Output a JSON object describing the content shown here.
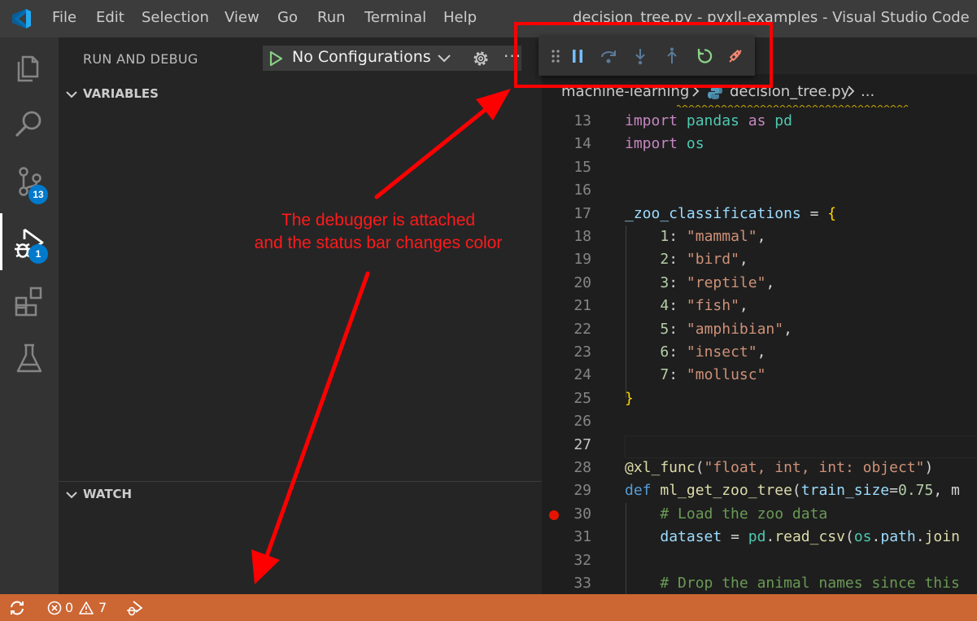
{
  "menu": [
    "File",
    "Edit",
    "Selection",
    "View",
    "Go",
    "Run",
    "Terminal",
    "Help"
  ],
  "window_title": "decision_tree.py - pyxll-examples - Visual Studio Code",
  "activity_bar": {
    "items": [
      "files-icon",
      "search-icon",
      "source-control-icon",
      "run-debug-icon",
      "extensions-icon",
      "testing-icon"
    ],
    "source_control_badge": "13",
    "debug_badge": "1"
  },
  "sidebar": {
    "title": "RUN AND DEBUG",
    "config_label": "No Configurations",
    "more": "···",
    "variables_label": "VARIABLES",
    "watch_label": "WATCH"
  },
  "breadcrumb": {
    "folder": "machine-learning",
    "file": "decision_tree.py",
    "more": "..."
  },
  "editor": {
    "lines": [
      {
        "n": "13",
        "html": "<span class='kw'>import</span> <span class='mod'>pandas</span> <span class='kw'>as</span> <span class='mod'>pd</span>"
      },
      {
        "n": "14",
        "html": "<span class='kw'>import</span> <span class='mod'>os</span>"
      },
      {
        "n": "15",
        "html": ""
      },
      {
        "n": "16",
        "html": ""
      },
      {
        "n": "17",
        "html": "<span class='var'>_zoo_classifications</span> <span class='plain'>=</span> <span class='brace'>{</span>"
      },
      {
        "n": "18",
        "html": "    <span class='num'>1</span><span class='plain'>:</span> <span class='str'>\"mammal\"</span><span class='plain'>,</span>"
      },
      {
        "n": "19",
        "html": "    <span class='num'>2</span><span class='plain'>:</span> <span class='str'>\"bird\"</span><span class='plain'>,</span>"
      },
      {
        "n": "20",
        "html": "    <span class='num'>3</span><span class='plain'>:</span> <span class='str'>\"reptile\"</span><span class='plain'>,</span>"
      },
      {
        "n": "21",
        "html": "    <span class='num'>4</span><span class='plain'>:</span> <span class='str'>\"fish\"</span><span class='plain'>,</span>"
      },
      {
        "n": "22",
        "html": "    <span class='num'>5</span><span class='plain'>:</span> <span class='str'>\"amphibian\"</span><span class='plain'>,</span>"
      },
      {
        "n": "23",
        "html": "    <span class='num'>6</span><span class='plain'>:</span> <span class='str'>\"insect\"</span><span class='plain'>,</span>"
      },
      {
        "n": "24",
        "html": "    <span class='num'>7</span><span class='plain'>:</span> <span class='str'>\"mollusc\"</span>"
      },
      {
        "n": "25",
        "html": "<span class='brace'>}</span>"
      },
      {
        "n": "26",
        "html": ""
      },
      {
        "n": "27",
        "html": ""
      },
      {
        "n": "28",
        "html": "<span class='fn'>@xl_func</span><span class='plain'>(</span><span class='str'>\"float, int, int: object\"</span><span class='plain'>)</span>"
      },
      {
        "n": "29",
        "html": "<span class='kwb'>def</span> <span class='fn'>ml_get_zoo_tree</span><span class='plain'>(</span><span class='var'>train_size</span><span class='plain'>=</span><span class='num'>0.75</span><span class='plain'>, m</span>"
      },
      {
        "n": "30",
        "html": "    <span class='cm'># Load the zoo data</span>"
      },
      {
        "n": "31",
        "html": "    <span class='var'>dataset</span> <span class='plain'>=</span> <span class='mod'>pd</span><span class='plain'>.</span><span class='fn'>read_csv</span><span class='plain'>(</span><span class='mod'>os</span><span class='plain'>.</span><span class='var'>path</span><span class='plain'>.</span><span class='fn'>join</span>"
      },
      {
        "n": "32",
        "html": ""
      },
      {
        "n": "33",
        "html": "    <span class='cm'># Drop the animal names since this</span>"
      }
    ]
  },
  "debug_toolbar": [
    "drag-handle-icon",
    "pause-icon",
    "step-over-icon",
    "step-into-icon",
    "step-out-icon",
    "restart-icon",
    "disconnect-icon"
  ],
  "annotation": {
    "line1": "The debugger is attached",
    "line2": "and the status bar changes color"
  },
  "statusbar": {
    "errors": "0",
    "warnings": "7",
    "color": "#cc6633"
  }
}
